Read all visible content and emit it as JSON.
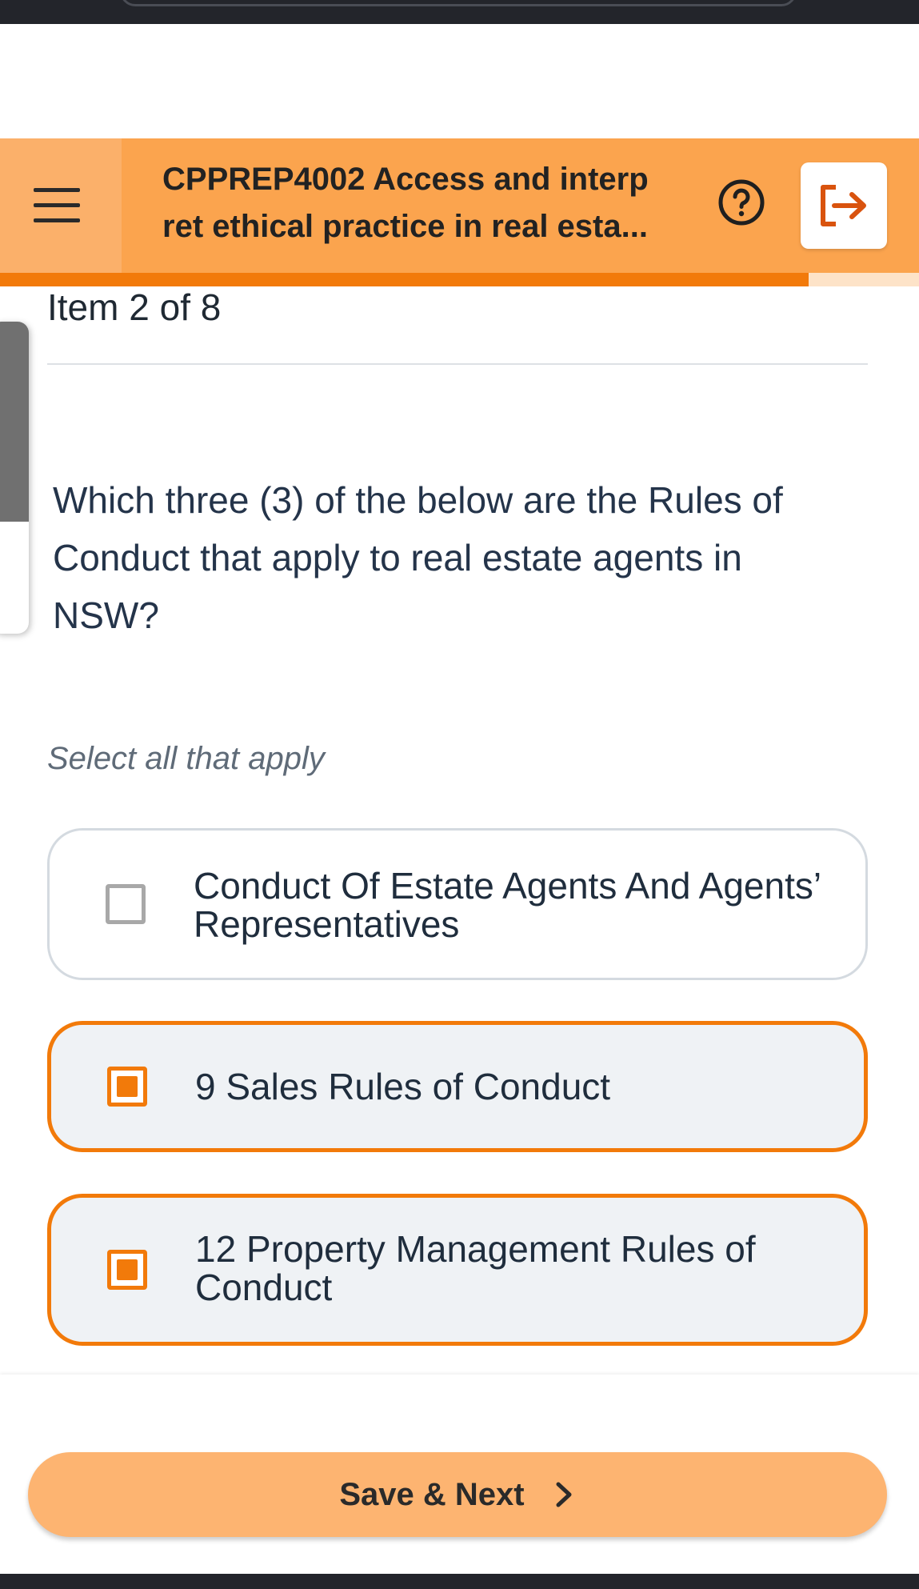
{
  "header": {
    "title": "CPPREP4002 Access and interp ret ethical practice in real esta...",
    "menu_icon": "hamburger-menu-icon",
    "help_icon": "question-circle-icon",
    "exit_icon": "logout-arrow-icon",
    "accent_color": "#fba44e"
  },
  "progress": {
    "fraction": 0.88,
    "color": "#f27a0a"
  },
  "question": {
    "counter": "Item 2 of 8",
    "text": "Which three (3) of the below are the Rules of Conduct that apply to real estate agents in NSW?",
    "hint": "Select all that apply"
  },
  "options": [
    {
      "label": "Conduct Of Estate Agents And Agents’ Representatives",
      "selected": false
    },
    {
      "label": "9 Sales Rules of Conduct",
      "selected": true
    },
    {
      "label": "12 Property Management Rules of Conduct",
      "selected": true
    }
  ],
  "footer": {
    "save_next_label": "Save & Next",
    "chevron_icon": "chevron-right-icon"
  }
}
